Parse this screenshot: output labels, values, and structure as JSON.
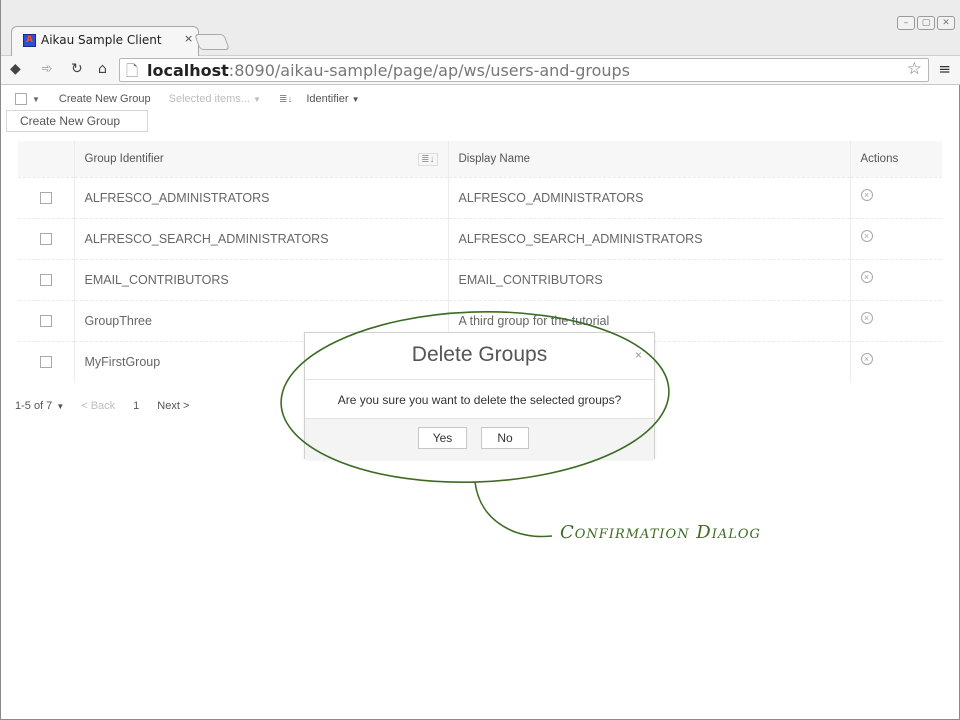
{
  "browser": {
    "tab_title": "Aikau Sample Client",
    "tab_close": "×",
    "favicon_letter": "A",
    "url_host": "localhost",
    "url_rest": ":8090/aikau-sample/page/ap/ws/users-and-groups",
    "icons": [
      "back-icon",
      "forward-icon",
      "reload-icon",
      "home-icon",
      "page-icon",
      "star-icon",
      "menu-icon"
    ]
  },
  "listbar": {
    "create_label": "Create New Group",
    "selected_label": "Selected items...",
    "sort_field": "Identifier",
    "caret": "▼"
  },
  "create_button": "Create New Group",
  "table": {
    "headers": [
      "",
      "Group Identifier",
      "Display Name",
      "Actions"
    ],
    "rows": [
      {
        "id": "ALFRESCO_ADMINISTRATORS",
        "display": "ALFRESCO_ADMINISTRATORS"
      },
      {
        "id": "ALFRESCO_SEARCH_ADMINISTRATORS",
        "display": "ALFRESCO_SEARCH_ADMINISTRATORS"
      },
      {
        "id": "EMAIL_CONTRIBUTORS",
        "display": "EMAIL_CONTRIBUTORS"
      },
      {
        "id": "GroupThree",
        "display": "A third group for the tutorial"
      },
      {
        "id": "MyFirstGroup",
        "display": ""
      }
    ]
  },
  "pager": {
    "range": "1-5 of 7",
    "back": "< Back",
    "page": "1",
    "next": "Next >"
  },
  "dialog": {
    "title": "Delete Groups",
    "close": "×",
    "message": "Are you sure you want to delete the selected groups?",
    "yes": "Yes",
    "no": "No"
  },
  "annotation": {
    "label": "Confirmation Dialog",
    "color": "#3d6b24"
  }
}
